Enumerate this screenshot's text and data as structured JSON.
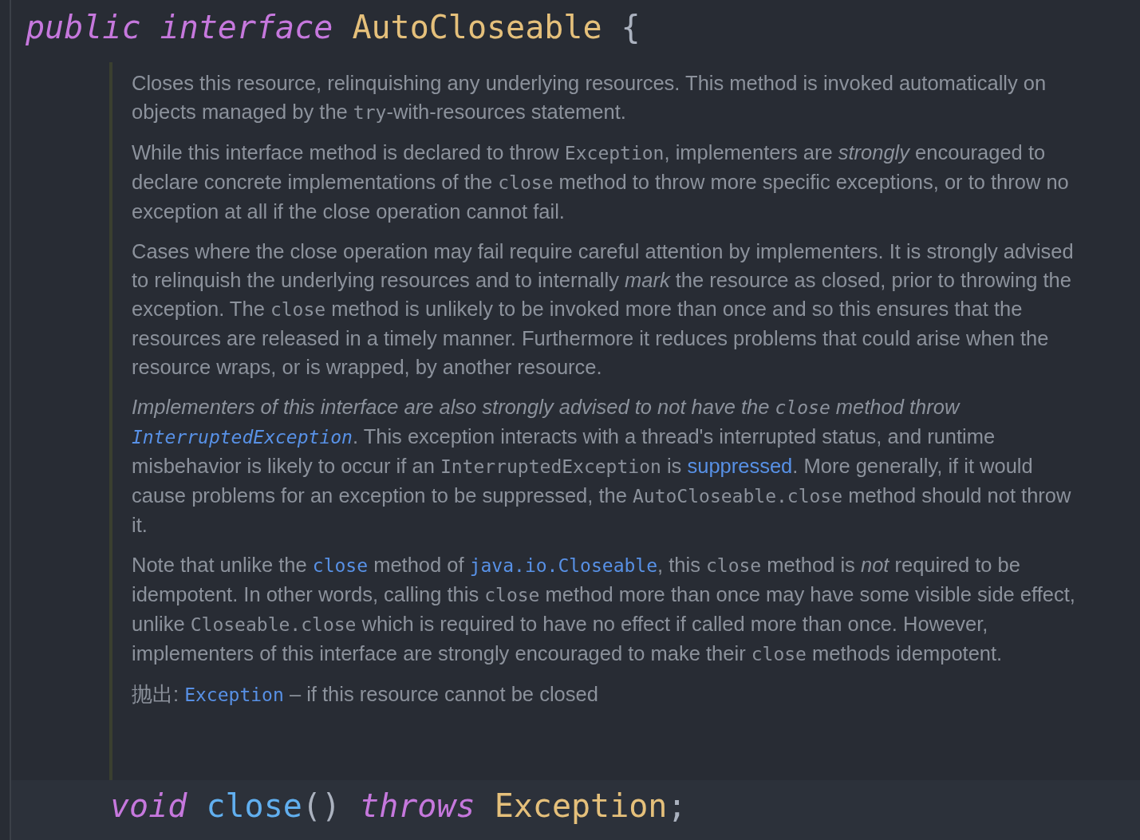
{
  "header_line": [
    {
      "kind": "keyword",
      "text": "public"
    },
    {
      "kind": "keyword",
      "text": "interface"
    },
    {
      "kind": "type",
      "text": "AutoCloseable"
    },
    {
      "kind": "punct",
      "text": "{"
    }
  ],
  "doc": {
    "paragraphs": [
      [
        {
          "kind": "text",
          "text": "Closes this resource, relinquishing any underlying resources. This method is invoked automatically on objects managed by the "
        },
        {
          "kind": "code",
          "text": "try"
        },
        {
          "kind": "text",
          "text": "-with-resources statement."
        }
      ],
      [
        {
          "kind": "text",
          "text": "While this interface method is declared to throw "
        },
        {
          "kind": "code",
          "text": "Exception"
        },
        {
          "kind": "text",
          "text": ", implementers are "
        },
        {
          "kind": "italic",
          "text": "strongly"
        },
        {
          "kind": "text",
          "text": " encouraged to declare concrete implementations of the "
        },
        {
          "kind": "code",
          "text": "close"
        },
        {
          "kind": "text",
          "text": " method to throw more specific exceptions, or to throw no exception at all if the close operation cannot fail."
        }
      ],
      [
        {
          "kind": "text",
          "text": "Cases where the close operation may fail require careful attention by implementers. It is strongly advised to relinquish the underlying resources and to internally "
        },
        {
          "kind": "italic",
          "text": "mark"
        },
        {
          "kind": "text",
          "text": " the resource as closed, prior to throwing the exception. The "
        },
        {
          "kind": "code",
          "text": "close"
        },
        {
          "kind": "text",
          "text": " method is unlikely to be invoked more than once and so this ensures that the resources are released in a timely manner. Furthermore it reduces problems that could arise when the resource wraps, or is wrapped, by another resource."
        }
      ],
      [
        {
          "kind": "italic",
          "text": "Implementers of this interface are also strongly advised to not have the "
        },
        {
          "kind": "code-italic",
          "text": "close"
        },
        {
          "kind": "italic",
          "text": " method throw "
        },
        {
          "kind": "code-link-italic",
          "text": "InterruptedException"
        },
        {
          "kind": "text",
          "text": ". This exception interacts with a thread's interrupted status, and runtime misbehavior is likely to occur if an "
        },
        {
          "kind": "code",
          "text": "InterruptedException"
        },
        {
          "kind": "text",
          "text": " is "
        },
        {
          "kind": "link",
          "text": "suppressed"
        },
        {
          "kind": "text",
          "text": ". More generally, if it would cause problems for an exception to be suppressed, the "
        },
        {
          "kind": "code",
          "text": "AutoCloseable.close"
        },
        {
          "kind": "text",
          "text": " method should not throw it."
        }
      ],
      [
        {
          "kind": "text",
          "text": "Note that unlike the "
        },
        {
          "kind": "code-link",
          "text": "close"
        },
        {
          "kind": "text",
          "text": " method of "
        },
        {
          "kind": "code-link",
          "text": "java.io.Closeable"
        },
        {
          "kind": "text",
          "text": ", this "
        },
        {
          "kind": "code",
          "text": "close"
        },
        {
          "kind": "text",
          "text": " method is "
        },
        {
          "kind": "italic",
          "text": "not"
        },
        {
          "kind": "text",
          "text": " required to be idempotent. In other words, calling this "
        },
        {
          "kind": "code",
          "text": "close"
        },
        {
          "kind": "text",
          "text": " method more than once may have some visible side effect, unlike "
        },
        {
          "kind": "code",
          "text": "Closeable.close"
        },
        {
          "kind": "text",
          "text": " which is required to have no effect if called more than once. However, implementers of this interface are strongly encouraged to make their "
        },
        {
          "kind": "code",
          "text": "close"
        },
        {
          "kind": "text",
          "text": " methods idempotent."
        }
      ]
    ],
    "throws": [
      {
        "kind": "text",
        "text": "抛出: "
      },
      {
        "kind": "code-link",
        "text": "Exception"
      },
      {
        "kind": "text",
        "text": " – if this resource cannot be closed"
      }
    ]
  },
  "method_line": [
    {
      "kind": "keyword",
      "text": "void"
    },
    {
      "kind": "method",
      "text": "close"
    },
    {
      "kind": "punct",
      "text": "()"
    },
    {
      "kind": "keyword",
      "text": "throws"
    },
    {
      "kind": "type",
      "text": "Exception"
    },
    {
      "kind": "punct",
      "text": ";"
    }
  ]
}
